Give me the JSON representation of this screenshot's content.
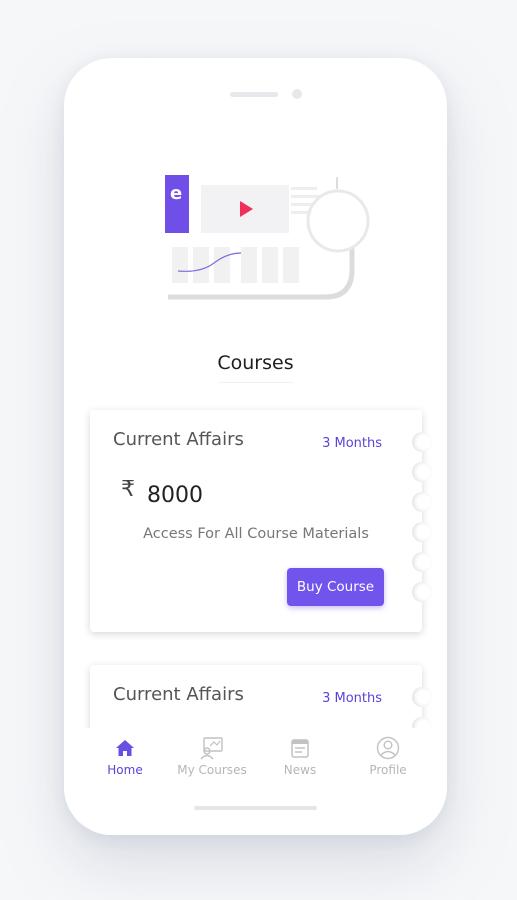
{
  "page_title": "Courses",
  "brand_letter": "e",
  "courses": [
    {
      "name": "Current Affairs",
      "duration": "3 Months",
      "currency": "₹",
      "price": "8000",
      "access": "Access For All Course Materials",
      "button": "Buy Course"
    },
    {
      "name": "Current Affairs",
      "duration": "3 Months"
    }
  ],
  "nav": [
    {
      "label": "Home",
      "icon": "home-icon",
      "active": true
    },
    {
      "label": "My Courses",
      "icon": "my-courses-icon",
      "active": false
    },
    {
      "label": "News",
      "icon": "news-icon",
      "active": false
    },
    {
      "label": "Profile",
      "icon": "profile-icon",
      "active": false
    }
  ],
  "colors": {
    "accent": "#7054eb",
    "accent_text": "#5b42d8",
    "inactive": "#b6b6b6"
  }
}
